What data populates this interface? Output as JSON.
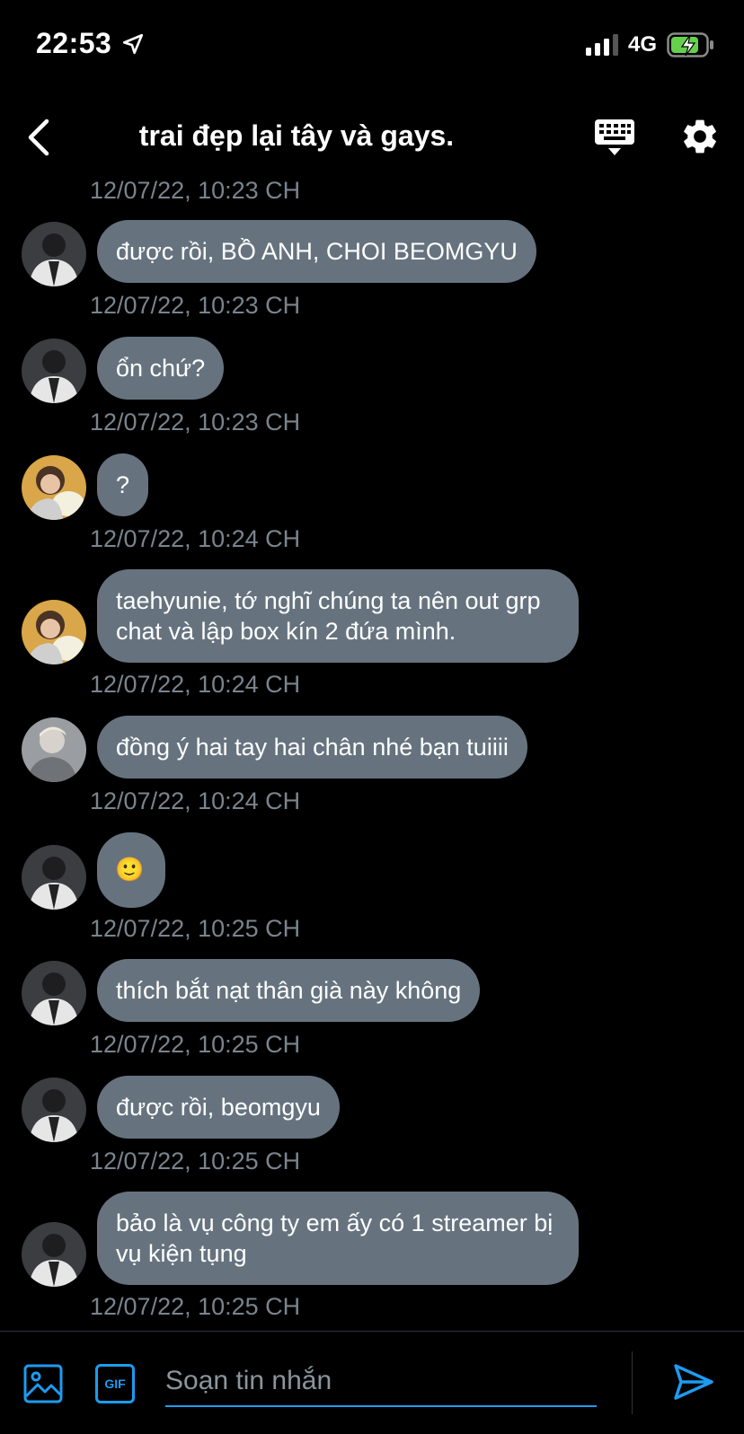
{
  "status_bar": {
    "time": "22:53",
    "network": "4G"
  },
  "header": {
    "title": "trai đẹp lại tây và gays."
  },
  "messages": [
    {
      "text": "được rồi, BỒ ANH, CHOI BEOMGYU",
      "timestamp": "12/07/22, 10:23 CH",
      "sender": "a"
    },
    {
      "text": "ổn chứ?",
      "timestamp": "12/07/22, 10:23 CH",
      "sender": "a"
    },
    {
      "text": "?",
      "timestamp": "12/07/22, 10:24 CH",
      "sender": "b"
    },
    {
      "text": "taehyunie, tớ nghĩ chúng ta nên out grp chat và lập box kín 2 đứa mình.",
      "timestamp": "12/07/22, 10:24 CH",
      "sender": "b"
    },
    {
      "text": "đồng ý hai tay hai chân nhé bạn tuiiii",
      "timestamp": "12/07/22, 10:24 CH",
      "sender": "c"
    },
    {
      "text": "🙂",
      "timestamp": "12/07/22, 10:25 CH",
      "sender": "a"
    },
    {
      "text": "thích bắt nạt thân già này không",
      "timestamp": "12/07/22, 10:25 CH",
      "sender": "a"
    },
    {
      "text": "được rồi, beomgyu",
      "timestamp": "12/07/22, 10:25 CH",
      "sender": "a"
    },
    {
      "text": "bảo là vụ công ty em ấy có 1 streamer bị vụ kiện tụng",
      "timestamp": "12/07/22, 10:25 CH",
      "sender": "a"
    }
  ],
  "top_timestamp": "12/07/22, 10:23 CH",
  "composer": {
    "placeholder": "Soạn tin nhắn",
    "gif_label": "GIF"
  },
  "colors": {
    "accent": "#1d9bf0",
    "bubble": "#66737f",
    "timestamp": "#7a848e"
  }
}
